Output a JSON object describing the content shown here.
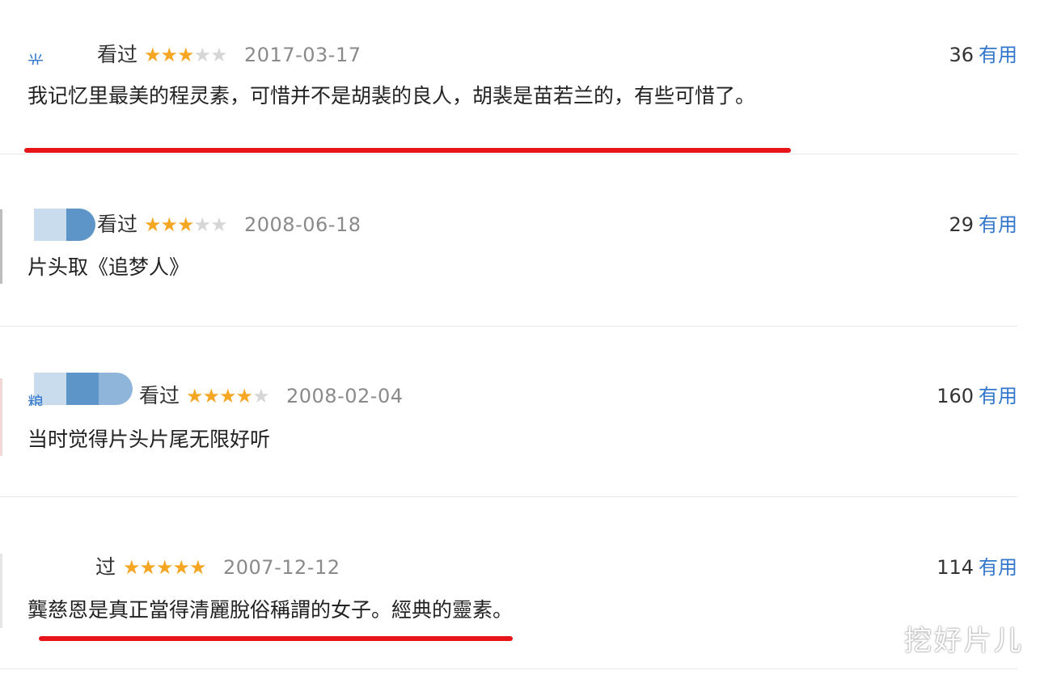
{
  "comments": [
    {
      "username_fragment": "光…",
      "status": "看过",
      "rating": 3,
      "date": "2017-03-17",
      "votes": "36",
      "vote_label": "有用",
      "text": "我记忆里最美的程灵素，可惜并不是胡裴的良人，胡裴是苗若兰的，有些可惜了。",
      "underlined": true
    },
    {
      "status": "看过",
      "rating": 3,
      "date": "2008-06-18",
      "votes": "29",
      "vote_label": "有用",
      "text": "片头取《追梦人》",
      "underlined": false
    },
    {
      "username_fragment": "粮…",
      "status": "看过",
      "rating": 4,
      "date": "2008-02-04",
      "votes": "160",
      "vote_label": "有用",
      "text": "当时觉得片头片尾无限好听",
      "underlined": false
    },
    {
      "status": "过",
      "rating": 5,
      "date": "2007-12-12",
      "votes": "114",
      "vote_label": "有用",
      "text": "龔慈恩是真正當得清麗脫俗稱謂的女子。經典的靈素。",
      "underlined": true
    }
  ],
  "icons": {
    "star": "star-icon"
  },
  "colors": {
    "star_on": "#f5a623",
    "star_off": "#d6d6d6",
    "link": "#3377cc",
    "highlight": "#e8141a"
  },
  "watermark": "挖好片儿"
}
